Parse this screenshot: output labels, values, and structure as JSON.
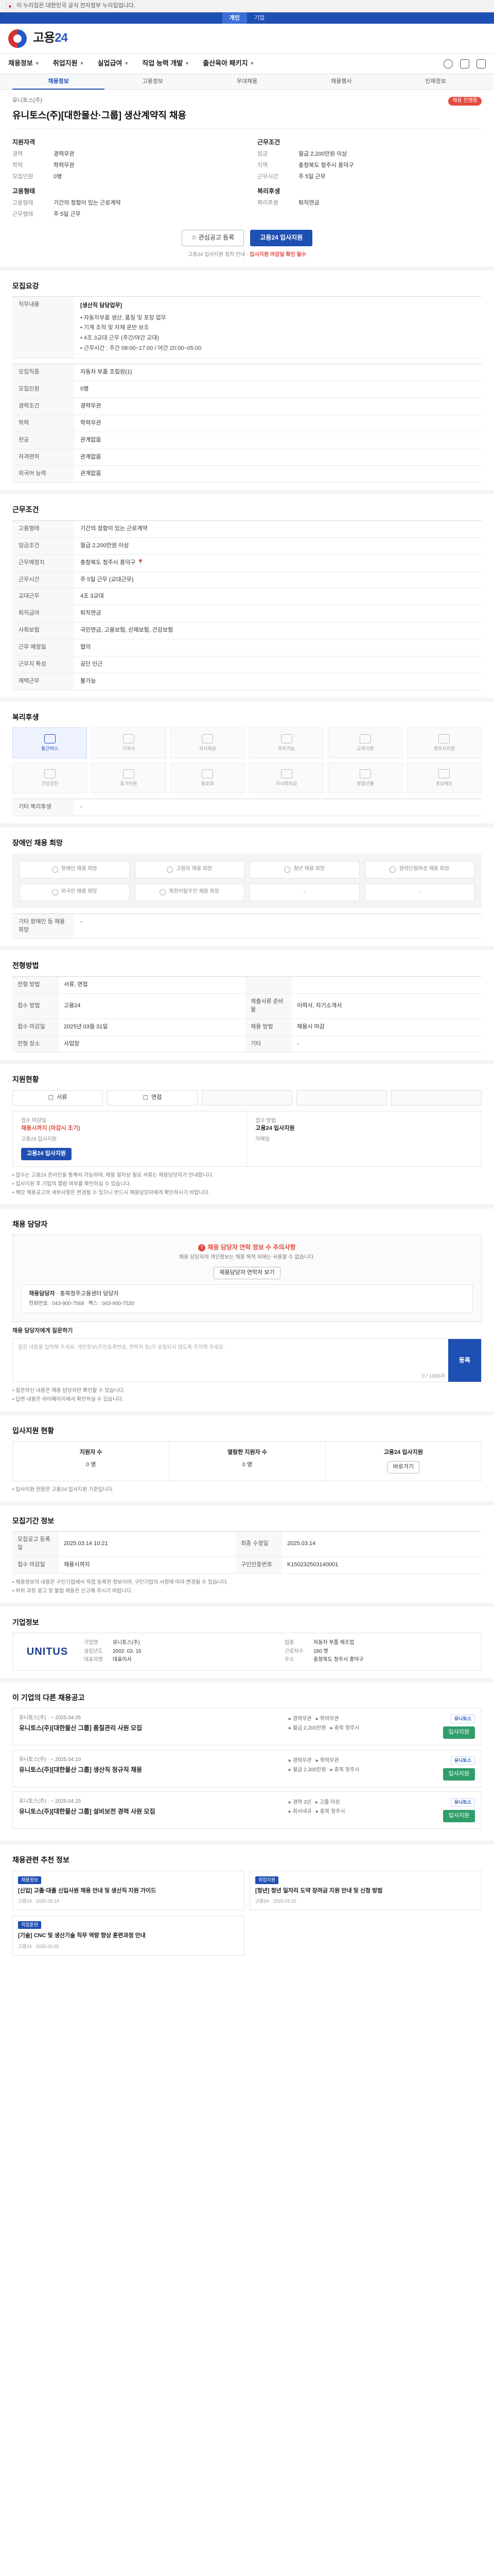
{
  "gov_banner": "이 누리집은 대한민국 공식 전자정부 누리집입니다.",
  "util_tabs": [
    "개인",
    "기업"
  ],
  "logo": {
    "word_a": "고용",
    "word_b": "24"
  },
  "gnb": [
    "채용정보",
    "취업지원",
    "실업급여",
    "직업 능력 개발",
    "출산육아 패키지"
  ],
  "subnav": [
    "채용정보",
    "고용정보",
    "우대채용",
    "채용행사",
    "인재정보"
  ],
  "summary": {
    "company": "유니토스(주)",
    "badge": "채용 진행중",
    "title": "유니토스(주)[대한물산·그룹] 생산계약직 채용",
    "recruit_heading": "지원자격",
    "work_heading": "근무조건",
    "recruit": [
      {
        "k": "경력",
        "v": "경력무관"
      },
      {
        "k": "학력",
        "v": "학력무관"
      },
      {
        "k": "모집인원",
        "v": "0명"
      }
    ],
    "work": [
      {
        "k": "임금",
        "v": "월급 2,200만원 이상"
      },
      {
        "k": "지역",
        "v": "충청북도 청주시 흥덕구"
      },
      {
        "k": "근무시간",
        "v": "주 5일 근무"
      }
    ],
    "emp_heading": "고용형태",
    "emp": [
      {
        "k": "고용형태",
        "v": "기간의 정함이 있는 근로계약"
      },
      {
        "k": "근무형태",
        "v": "주 5일 근무"
      }
    ],
    "extra_heading": "복리후생",
    "extra": [
      {
        "k": "복리후생",
        "v": "퇴직연금"
      }
    ],
    "btn_interest": "관심공고 등록",
    "btn_apply": "고용24 입사지원",
    "notice_a": "고용24 입사지원 절차 안내",
    "notice_b": "입사지원 마감일 확인 필수"
  },
  "duty": {
    "heading": "모집요강",
    "label": "직무내용",
    "title": "[생산직 담당업무]",
    "lines": [
      "• 자동차부품 생산, 품질 및 포장 업무",
      "• 기계 조작 및 자재 운반 보조",
      "• 4조 3교대 근무 (주간/야간 교대)",
      "• 근무시간 : 주간 08:00~17:00 / 야간 20:00~05:00"
    ]
  },
  "recruit_table": [
    {
      "k": "모집직종",
      "v": "자동차 부품 조립원(1)"
    },
    {
      "k": "모집인원",
      "v": "0명"
    },
    {
      "k": "경력조건",
      "v": "경력무관"
    },
    {
      "k": "학력",
      "v": "학력무관"
    },
    {
      "k": "전공",
      "v": "관계없음"
    },
    {
      "k": "자격면허",
      "v": "관계없음"
    },
    {
      "k": "외국어 능력",
      "v": "관계없음"
    }
  ],
  "work_heading": "근무조건",
  "work_table": [
    {
      "k": "고용형태",
      "v": "기간의 정함이 있는 근로계약"
    },
    {
      "k": "임금조건",
      "v": "월급 2,200만원 이상"
    },
    {
      "k": "근무예정지",
      "v": "충청북도 청주시 흥덕구"
    },
    {
      "k": "근무시간",
      "v": "주 5일 근무 (교대근무)"
    },
    {
      "k": "교대근무",
      "v": "4조 3교대"
    },
    {
      "k": "퇴직급여",
      "v": "퇴직연금"
    },
    {
      "k": "사회보험",
      "v": "국민연금, 고용보험, 산재보험, 건강보험"
    },
    {
      "k": "근무 예정일",
      "v": "협의"
    },
    {
      "k": "근무지 특성",
      "v": "공단 인근"
    },
    {
      "k": "재택근무",
      "v": "불가능"
    }
  ],
  "welfare_heading": "복리후생",
  "welfare_items": [
    {
      "label": "통근버스",
      "on": true
    },
    {
      "label": "기숙사",
      "on": false
    },
    {
      "label": "식사제공",
      "on": false
    },
    {
      "label": "주차가능",
      "on": false
    },
    {
      "label": "교육지원",
      "on": false
    },
    {
      "label": "경조사지원",
      "on": false
    },
    {
      "label": "건강검진",
      "on": false
    },
    {
      "label": "휴가지원",
      "on": false
    },
    {
      "label": "동호회",
      "on": false
    },
    {
      "label": "자녀학자금",
      "on": false
    },
    {
      "label": "명절선물",
      "on": false
    },
    {
      "label": "포상제도",
      "on": false
    }
  ],
  "welfare_note": "기타 복리후생",
  "welfare_note_val": "-",
  "hire_heading": "장애인 채용 희망",
  "hire_items": [
    "장애인 채용 희망",
    "고령자 채용 희망",
    "청년 채용 희망",
    "경력단절여성 채용 희망",
    "외국인 채용 희망",
    "북한이탈주민 채용 희망",
    "-",
    "-"
  ],
  "hire_note": "기타 장애인 등 채용희망",
  "hire_note_val": "-",
  "proc_heading": "전형방법",
  "proc_table": [
    {
      "k1": "전형 방법",
      "v1": "서류, 면접",
      "k2": "",
      "v2": ""
    },
    {
      "k1": "접수 방법",
      "v1": "고용24",
      "k2": "제출서류 준비물",
      "v2": "이력서, 자기소개서"
    },
    {
      "k1": "접수 마감일",
      "v1": "2025년 03월 31일",
      "k2": "채용 방법",
      "v2": "채용시 마감"
    },
    {
      "k1": "전형 장소",
      "v1": "사업장",
      "k2": "기타",
      "v2": "-"
    }
  ],
  "steps_heading": "지원현황",
  "steps": [
    "서류",
    "면접",
    "",
    "",
    ""
  ],
  "apply": {
    "col1_label": "접수 마감일",
    "col1_val": "채용시까지 (마감시 조기)",
    "col1_sub": "고용24 입사지원",
    "col2_label": "접수 방법",
    "col2_val": "고용24 입사지원",
    "col2_sub": "이메일",
    "btn": "고용24 입사지원",
    "notes": [
      "• 접수는 고용24 온라인을 통해서 가능하며, 채용 절차상 필요 서류는 채용담당자가 안내합니다.",
      "• 입사지원 후 기업의 열람 여부를 확인하실 수 있습니다.",
      "• 해당 채용공고의 세부사항은 변경될 수 있으니 반드시 채용담당자에게 확인하시기 바랍니다."
    ]
  },
  "contact_heading": "채용 담당자",
  "contact": {
    "warn": "채용 담당자 연락 정보 수 주의사항",
    "sub": "채용 담당자의 개인정보는 채용 목적 외에는 사용할 수 없습니다.",
    "btn": "채용담당자 연락처 보기",
    "card_label": "채용담당자",
    "card_name": "충북청주고용센터 담당자",
    "card_phone_label": "전화번호",
    "card_phone": "043-900-7568",
    "card_fax_label": "팩스",
    "card_fax": "043-900-7520"
  },
  "inquiry": {
    "label": "채용 담당자에게 질문하기",
    "placeholder": "질문 내용을 입력해 주세요. 개인정보(주민등록번호, 연락처 등)가 포함되지 않도록 주의해 주세요.",
    "count": "0 / 1000자",
    "btn": "등록",
    "notes": [
      "• 질문하신 내용은 채용 담당자만 확인할 수 있습니다.",
      "• 답변 내용은 마이페이지에서 확인하실 수 있습니다."
    ]
  },
  "docs_heading": "입사지원 현황",
  "docs": [
    {
      "t": "지원자 수",
      "v": "0 명"
    },
    {
      "t": "열람한 지원자 수",
      "v": "0 명"
    },
    {
      "t": "고용24 입사지원",
      "v": "바로가기"
    }
  ],
  "docs_note": "• 입사지원 현황은 고용24 입사지원 기준입니다.",
  "period_heading": "모집기간 정보",
  "period_table": [
    {
      "k1": "모집공고 등록일",
      "v1": "2025.03.14 10:21",
      "k2": "최종 수정일",
      "v2": "2025.03.14"
    },
    {
      "k1": "접수 마감일",
      "v1": "채용시까지",
      "k2": "구인인증번호",
      "v2": "K150232503140001"
    }
  ],
  "period_notes": [
    "• 채용정보의 내용은 구인기업에서 직접 등록한 정보이며, 구인기업의 사정에 따라 변경될 수 있습니다.",
    "• 허위 과장 광고 및 불법 채용은 신고해 주시기 바랍니다."
  ],
  "company_heading": "기업정보",
  "company": {
    "logo": "UNITUS",
    "rows": [
      {
        "k": "기업명",
        "v": "유니토스(주)"
      },
      {
        "k": "업종",
        "v": "자동차 부품 제조업"
      },
      {
        "k": "설립년도",
        "v": "2002. 03. 15"
      },
      {
        "k": "근로자수",
        "v": "180 명"
      },
      {
        "k": "대표자명",
        "v": "대표이사"
      },
      {
        "k": "주소",
        "v": "충청북도 청주시 흥덕구"
      }
    ]
  },
  "rec_heading": "이 기업의 다른 채용공고",
  "recs": [
    {
      "co": "유니토스(주)",
      "date": "~ 2025.04.05",
      "title": "유니토스(주)[대한물산 그룹] 품질관리 사원 모집",
      "m1": "경력무관",
      "m2": "학력무관",
      "m3": "월급 2,200만원",
      "m4": "충북 청주시",
      "logo": "유니토스",
      "btn": "입사지원"
    },
    {
      "co": "유니토스(주)",
      "date": "~ 2025.04.10",
      "title": "유니토스(주)[대한물산 그룹] 생산직 정규직 채용",
      "m1": "경력무관",
      "m2": "학력무관",
      "m3": "월급 2,300만원",
      "m4": "충북 청주시",
      "logo": "유니토스",
      "btn": "입사지원"
    },
    {
      "co": "유니토스(주)",
      "date": "~ 2025.04.15",
      "title": "유니토스(주)[대한물산 그룹] 설비보전 경력 사원 모집",
      "m1": "경력 3년",
      "m2": "고졸 이상",
      "m3": "회사내규",
      "m4": "충북 청주시",
      "logo": "유니토스",
      "btn": "입사지원"
    }
  ],
  "news_heading": "채용관련 추천 정보",
  "news": [
    {
      "tag": "채용정보",
      "title": "[신입] 고졸·대졸 신입사원 채용 안내 및 생산직 지원 가이드",
      "foot": "고용24 · 2025.03.14"
    },
    {
      "tag": "취업지원",
      "title": "[청년] 청년 일자리 도약 장려금 지원 안내 및 신청 방법",
      "foot": "고용24 · 2025.03.10"
    },
    {
      "tag": "직업훈련",
      "title": "[기술] CNC 및 생산기술 직무 역량 향상 훈련과정 안내",
      "foot": "고용24 · 2025.03.05"
    }
  ]
}
